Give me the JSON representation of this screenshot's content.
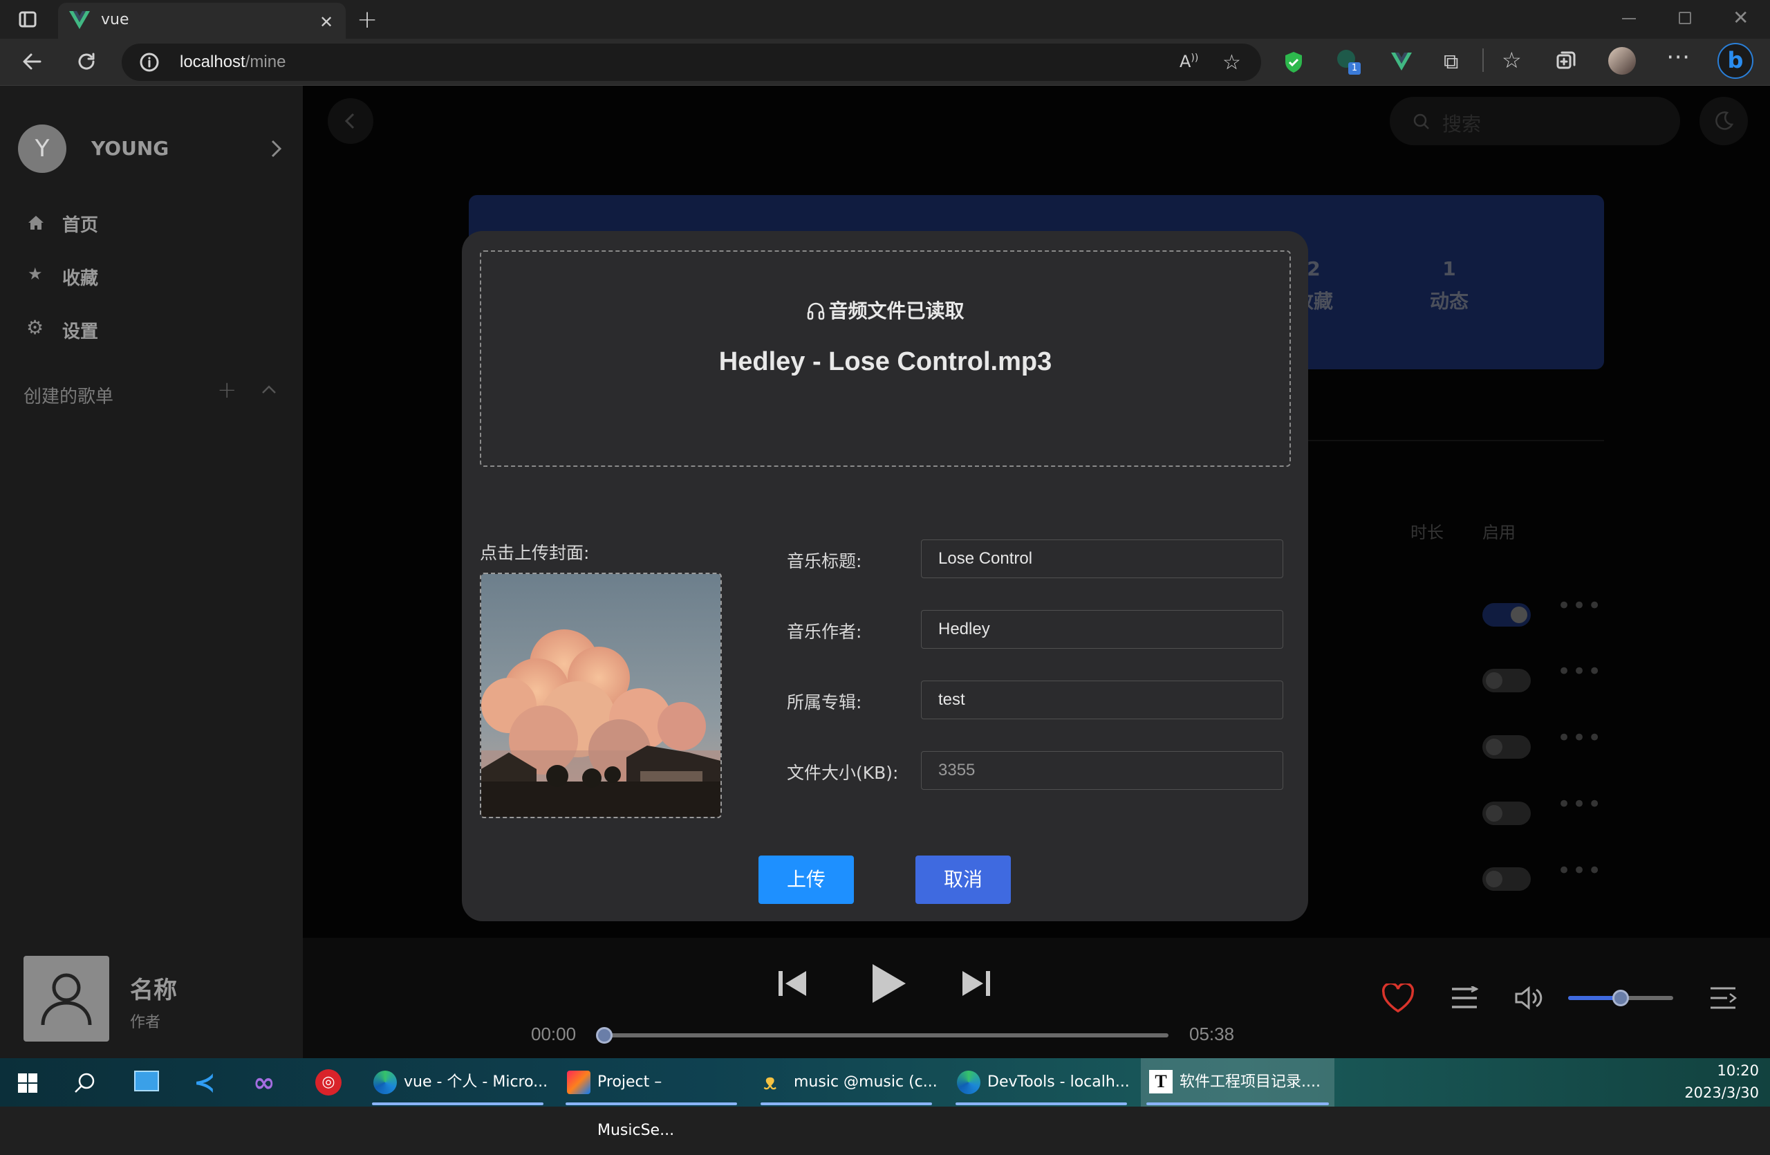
{
  "browser": {
    "tab_title": "vue",
    "url_host": "localhost",
    "url_path": "/mine",
    "extension_badge": "1"
  },
  "sidebar": {
    "avatar_letter": "Y",
    "username": "YOUNG",
    "nav": [
      {
        "label": "首页",
        "icon": "home-icon"
      },
      {
        "label": "收藏",
        "icon": "star-icon"
      },
      {
        "label": "设置",
        "icon": "gear-icon"
      }
    ],
    "playlists_header": "创建的歌单"
  },
  "header": {
    "search_placeholder": "搜索"
  },
  "profile_card": {
    "stats": [
      {
        "count": "2",
        "label": "收藏"
      },
      {
        "count": "1",
        "label": "动态"
      }
    ],
    "accent": "#2b4aa8"
  },
  "table": {
    "columns": [
      "时长",
      "启用"
    ],
    "rows": [
      {
        "enabled": true
      },
      {
        "enabled": false
      },
      {
        "enabled": false
      },
      {
        "enabled": false
      },
      {
        "enabled": false
      }
    ]
  },
  "upload_dialog": {
    "status": "音频文件已读取",
    "filename": "Hedley - Lose Control.mp3",
    "cover_label": "点击上传封面:",
    "fields": [
      {
        "label": "音乐标题:",
        "value": "Lose Control"
      },
      {
        "label": "音乐作者:",
        "value": "Hedley"
      },
      {
        "label": "所属专辑:",
        "value": "test"
      },
      {
        "label": "文件大小(KB):",
        "value": "3355"
      }
    ],
    "upload_label": "上传",
    "cancel_label": "取消",
    "upload_color": "#1e90ff",
    "cancel_color": "#3f6ae0"
  },
  "player": {
    "track_name": "名称",
    "track_artist": "作者",
    "current_time": "00:00",
    "total_time": "05:38",
    "progress": 0.0,
    "volume": 0.5
  },
  "taskbar": {
    "apps": [
      {
        "label": "vue - 个人 - Micro...",
        "icon": "edge-icon"
      },
      {
        "label": "Project – MusicSe...",
        "icon": "intellij-icon"
      },
      {
        "label": "music @music (c...",
        "icon": "navicat-icon"
      },
      {
        "label": "DevTools - localh...",
        "icon": "edge-icon"
      },
      {
        "label": "软件工程项目记录....",
        "icon": "typora-icon"
      }
    ],
    "time": "10:20",
    "date": "2023/3/30"
  }
}
